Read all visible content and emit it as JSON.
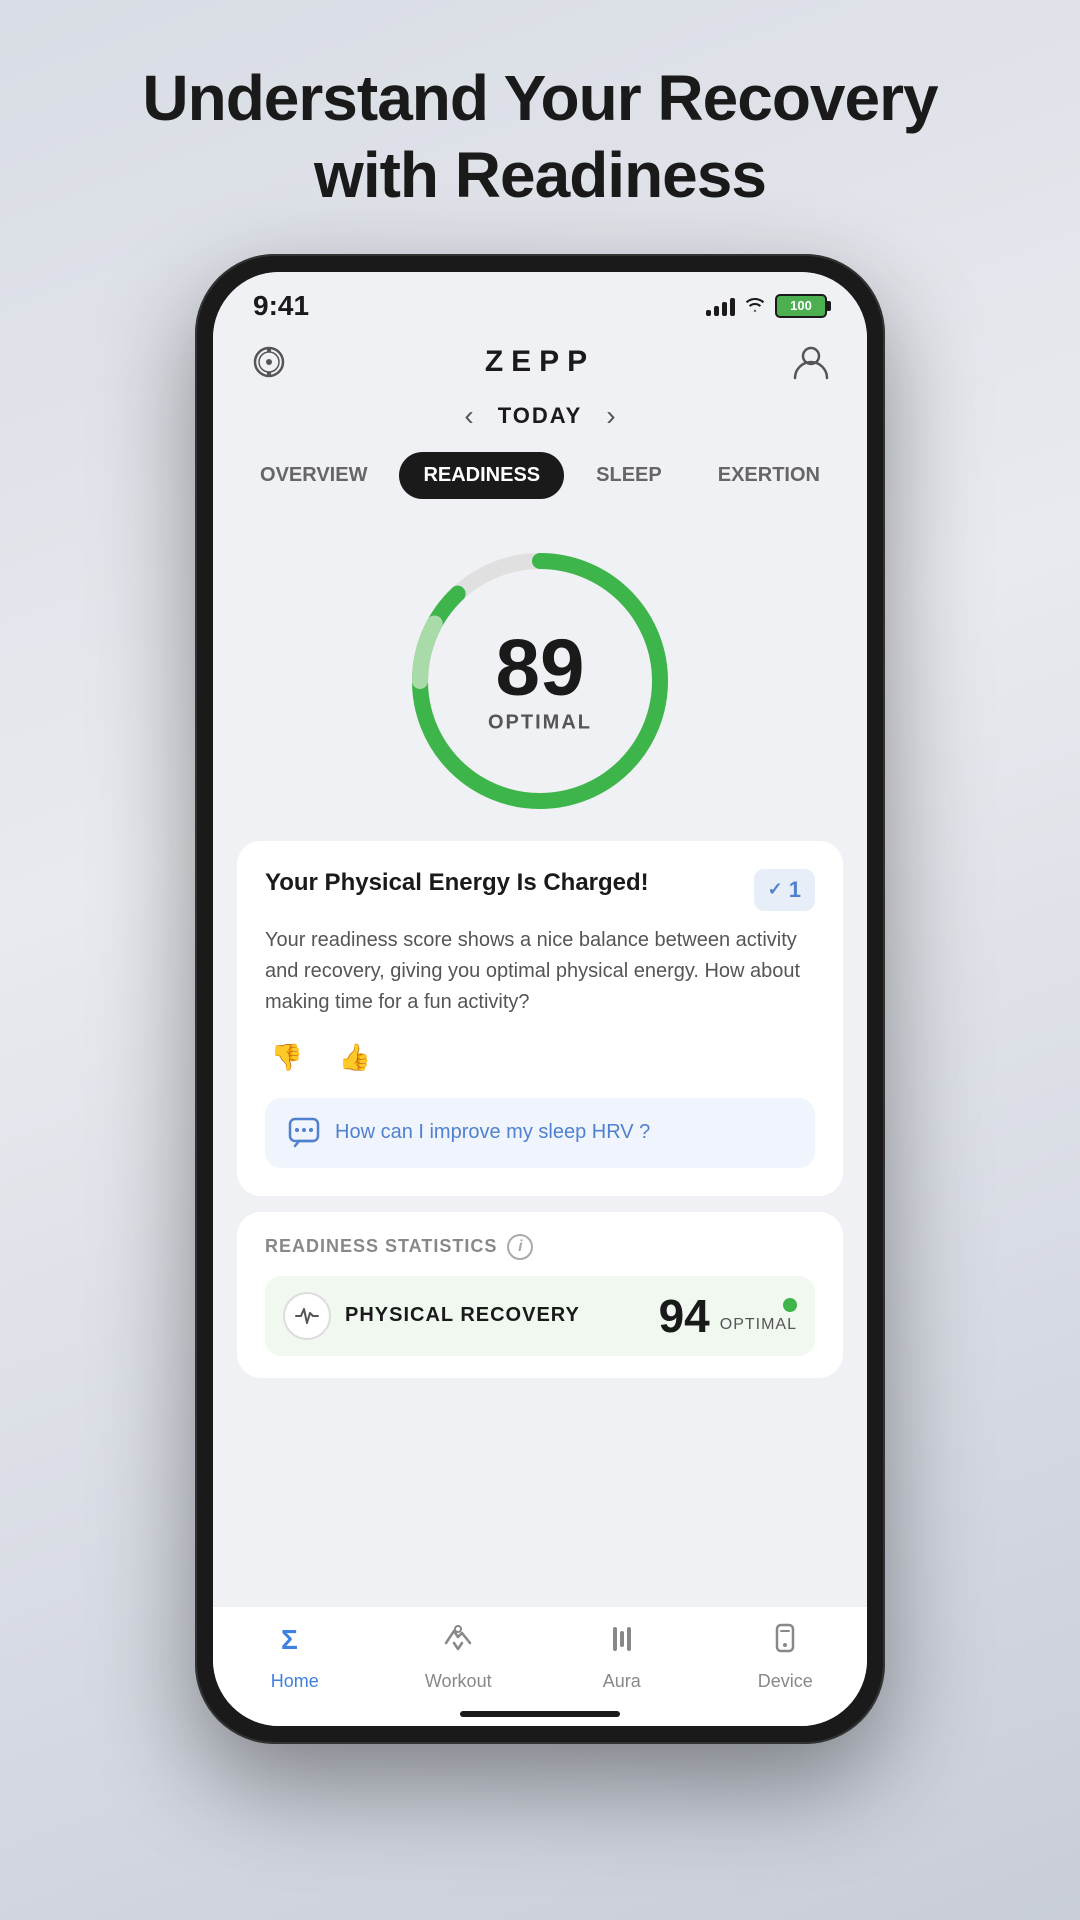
{
  "page": {
    "background_title_line1": "Understand Your Recovery",
    "background_title_line2": "with Readiness"
  },
  "status_bar": {
    "time": "9:41",
    "battery_label": "100"
  },
  "header": {
    "logo": "ZEPP"
  },
  "date_nav": {
    "label": "TODAY",
    "prev_arrow": "‹",
    "next_arrow": "›"
  },
  "tabs": [
    {
      "id": "overview",
      "label": "OVERVIEW",
      "active": false
    },
    {
      "id": "readiness",
      "label": "READINESS",
      "active": true
    },
    {
      "id": "sleep",
      "label": "SLEEP",
      "active": false
    },
    {
      "id": "exertion",
      "label": "EXERTION",
      "active": false
    }
  ],
  "gauge": {
    "score": "89",
    "status": "OPTIMAL"
  },
  "insight_card": {
    "title": "Your Physical Energy Is Charged!",
    "body": "Your readiness score shows a nice balance between activity and recovery, giving you optimal physical energy. How about making time for a fun activity?",
    "badge_count": "1",
    "ai_prompt": "How can I improve my sleep HRV ?"
  },
  "stats_section": {
    "title": "READINESS STATISTICS",
    "rows": [
      {
        "icon": "activity-icon",
        "name": "PHYSICAL RECOVERY",
        "value": "94",
        "status_label": "OPTIMAL",
        "dot_color": "#3db54a"
      }
    ]
  },
  "bottom_nav": {
    "items": [
      {
        "id": "home",
        "label": "Home",
        "active": true
      },
      {
        "id": "workout",
        "label": "Workout",
        "active": false
      },
      {
        "id": "aura",
        "label": "Aura",
        "active": false
      },
      {
        "id": "device",
        "label": "Device",
        "active": false
      }
    ]
  }
}
